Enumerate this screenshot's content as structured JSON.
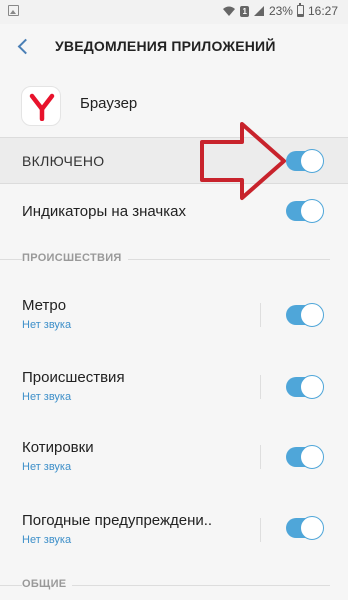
{
  "statusbar": {
    "sim_badge": "1",
    "battery": "23%",
    "time": "16:27"
  },
  "header": {
    "title": "УВЕДОМЛЕНИЯ ПРИЛОЖЕНИЙ"
  },
  "app": {
    "name": "Браузер"
  },
  "enabled": {
    "label": "ВКЛЮЧЕНО",
    "on": true
  },
  "badges": {
    "label": "Индикаторы на значках",
    "on": true
  },
  "section_incidents": {
    "title": "ПРОИСШЕСТВИЯ"
  },
  "channels": [
    {
      "label": "Метро",
      "sub": "Нет звука",
      "on": true
    },
    {
      "label": "Происшествия",
      "sub": "Нет звука",
      "on": true
    },
    {
      "label": "Котировки",
      "sub": "Нет звука",
      "on": true
    },
    {
      "label": "Погодные предупреждени..",
      "sub": "Нет звука",
      "on": true
    }
  ],
  "section_general": {
    "title": "ОБЩИЕ"
  },
  "colors": {
    "accent": "#4fa6d9",
    "subtext": "#3d8fc9",
    "arrow": "#c8232c",
    "app_logo": "#e8132c"
  }
}
